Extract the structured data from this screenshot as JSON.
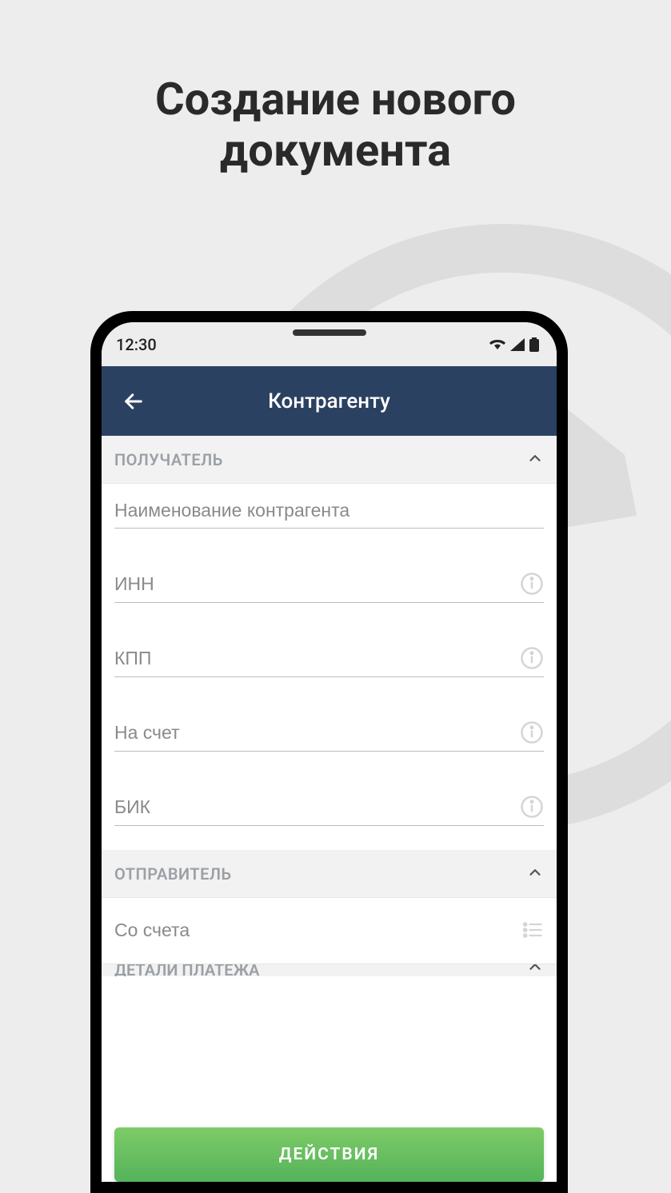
{
  "promo": {
    "title_line1": "Создание нового",
    "title_line2": "документа"
  },
  "status": {
    "time": "12:30"
  },
  "header": {
    "title": "Контрагенту"
  },
  "sections": {
    "receiver": {
      "label": "ПОЛУЧАТЕЛЬ"
    },
    "sender": {
      "label": "ОТПРАВИТЕЛЬ"
    },
    "details": {
      "label": "ДЕТАЛИ ПЛАТЕЖА"
    }
  },
  "fields": {
    "counterparty": {
      "placeholder": "Наименование контрагента"
    },
    "inn": {
      "placeholder": "ИНН"
    },
    "kpp": {
      "placeholder": "КПП"
    },
    "account_to": {
      "placeholder": "На счет"
    },
    "bik": {
      "placeholder": "БИК"
    },
    "account_from": {
      "placeholder": "Со счета"
    }
  },
  "actions": {
    "label": "ДЕЙСТВИЯ"
  }
}
